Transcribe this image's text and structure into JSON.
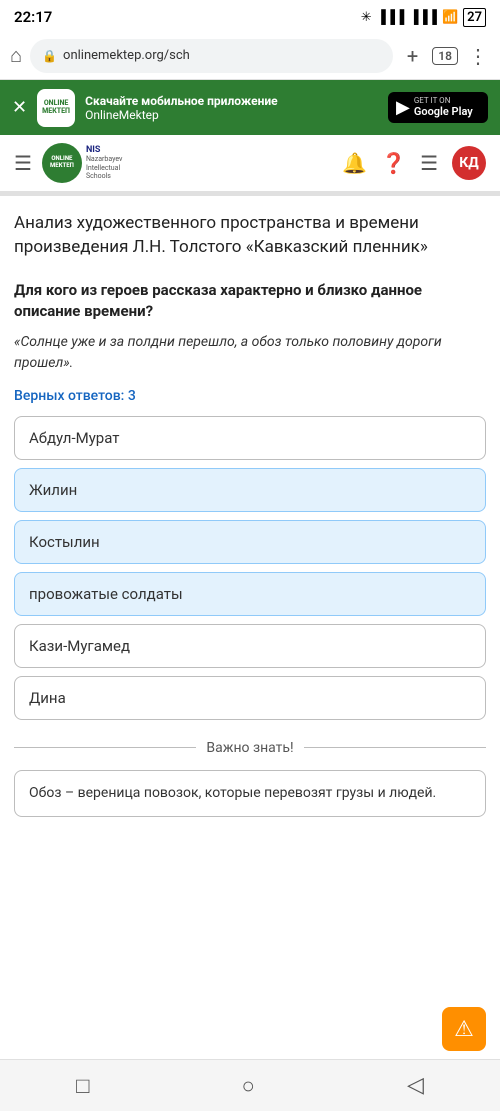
{
  "statusBar": {
    "time": "22:17",
    "batteryLevel": "27"
  },
  "browserBar": {
    "url": "onlinemektep.org/sch",
    "tabsCount": "18"
  },
  "appBanner": {
    "logoLine1": "ONLINE",
    "logoLine2": "МЕКТЕП",
    "titleText": "Скачайте мобильное приложение",
    "subtitleText": "OnlineMektep",
    "googlePlayLabel": "Google Play",
    "googlePlaySub": "GET IT ON"
  },
  "siteHeader": {
    "logoLine1": "ONLINE",
    "logoLine2": "МЕКТЕП",
    "nisTitle": "NIS",
    "nisSub": "Nazarbayev\nIntellectual\nSchools",
    "avatarText": "КД"
  },
  "pageTitle": "Анализ художественного пространства и времени произведения Л.Н. Толстого «Кавказский пленник»",
  "question": {
    "text": "Для кого из героев рассказа характерно и близко данное описание времени?",
    "quote": "«Солнце уже и за полдни перешло, а обоз только половину дороги прошел».",
    "correctCount": "Верных ответов: 3"
  },
  "answers": [
    {
      "label": "Абдул-Мурат",
      "selected": false
    },
    {
      "label": "Жилин",
      "selected": true
    },
    {
      "label": "Костылин",
      "selected": true
    },
    {
      "label": "провожатые солдаты",
      "selected": true
    },
    {
      "label": "Кази-Мугамед",
      "selected": false
    },
    {
      "label": "Дина",
      "selected": false
    }
  ],
  "importantBox": {
    "dividerLabel": "Важно знать!",
    "text": "Обоз – вереница повозок, которые перевозят грузы и людей."
  },
  "bottomNav": {
    "squareIcon": "□",
    "circleIcon": "○",
    "triangleIcon": "◁"
  }
}
